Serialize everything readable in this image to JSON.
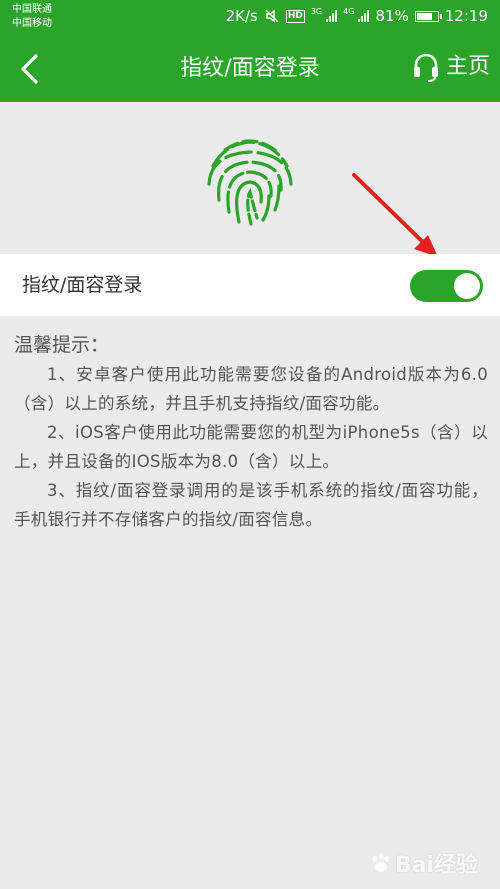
{
  "status_bar": {
    "carrier_1": "中国联通",
    "carrier_2": "中国移动",
    "speed": "2K/s",
    "hd_label": "HD",
    "net_3g": "3G",
    "net_4g": "4G",
    "battery": "81%",
    "battery_level": 0.81,
    "time": "12:19",
    "icons": [
      "mute-icon",
      "signal-icon",
      "battery-icon"
    ]
  },
  "nav": {
    "title": "指纹/面容登录",
    "home_label": "主页",
    "icons": [
      "chevron-left-icon",
      "headset-icon"
    ]
  },
  "fingerprint": {
    "icon": "fingerprint-icon",
    "color": "#2aa52a"
  },
  "setting": {
    "label": "指纹/面容登录",
    "enabled": true
  },
  "tips": {
    "title": "温馨提示：",
    "items": [
      "1、安卓客户使用此功能需要您设备的Android版本为6.0（含）以上的系统，并且手机支持指纹/面容功能。",
      "2、iOS客户使用此功能需要您的机型为iPhone5s（含）以上，并且设备的IOS版本为8.0（含）以上。",
      "3、指纹/面容登录调用的是该手机系统的指纹/面容功能，手机银行并不存储客户的指纹/面容信息。"
    ]
  },
  "watermark": {
    "text": "Bai经验"
  },
  "colors": {
    "brand_green": "#2aa52a",
    "annotation_red": "#e8201f",
    "background": "#ebebeb"
  }
}
